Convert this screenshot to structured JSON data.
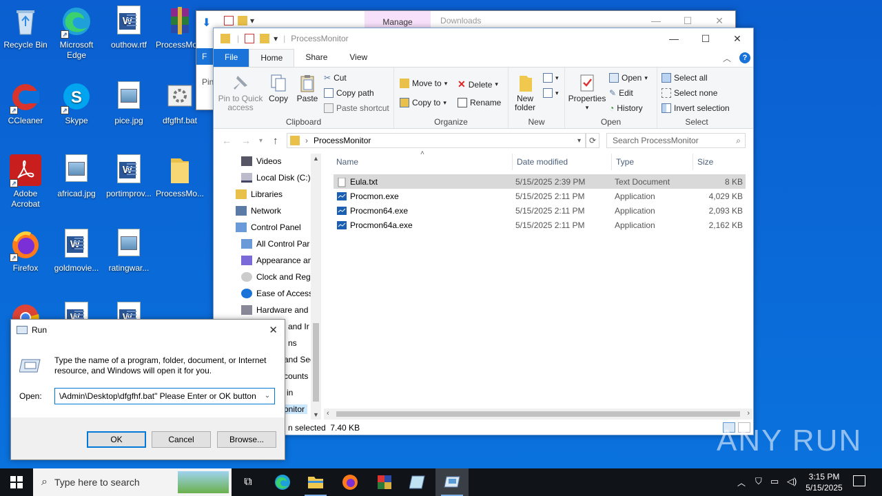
{
  "desktop_icons": [
    {
      "label": "Recycle Bin",
      "icon": "recycle-bin-icon"
    },
    {
      "label": "Microsoft Edge",
      "icon": "edge-icon"
    },
    {
      "label": "outhow.rtf",
      "icon": "word-doc-icon"
    },
    {
      "label": "ProcessMo...",
      "icon": "winrar-icon"
    },
    {
      "label": "CCleaner",
      "icon": "ccleaner-icon"
    },
    {
      "label": "Skype",
      "icon": "skype-icon"
    },
    {
      "label": "pice.jpg",
      "icon": "image-file-icon"
    },
    {
      "label": "dfgfhf.bat",
      "icon": "batch-file-icon"
    },
    {
      "label": "Adobe Acrobat",
      "icon": "acrobat-icon"
    },
    {
      "label": "africad.jpg",
      "icon": "image-file-icon"
    },
    {
      "label": "portimprov...",
      "icon": "word-doc-icon"
    },
    {
      "label": "ProcessMo...",
      "icon": "folder-icon"
    },
    {
      "label": "Firefox",
      "icon": "firefox-icon"
    },
    {
      "label": "goldmovie...",
      "icon": "word-doc-icon"
    },
    {
      "label": "ratingwar...",
      "icon": "image-file-icon"
    }
  ],
  "back_window": {
    "tab_manage": "Manage",
    "title": "Downloads",
    "file_tab": "F",
    "pin_label": "Pin"
  },
  "explorer": {
    "title": "ProcessMonitor",
    "tabs": [
      "File",
      "Home",
      "Share",
      "View"
    ],
    "clipboard": {
      "pin": "Pin to Quick access",
      "copy": "Copy",
      "paste": "Paste",
      "cut": "Cut",
      "copy_path": "Copy path",
      "paste_shortcut": "Paste shortcut",
      "label": "Clipboard"
    },
    "organize": {
      "move_to": "Move to",
      "copy_to": "Copy to",
      "delete": "Delete",
      "rename": "Rename",
      "label": "Organize"
    },
    "new": {
      "new_folder": "New folder",
      "label": "New"
    },
    "open": {
      "properties": "Properties",
      "open": "Open",
      "edit": "Edit",
      "history": "History",
      "label": "Open"
    },
    "select": {
      "select_all": "Select all",
      "select_none": "Select none",
      "invert": "Invert selection",
      "label": "Select"
    },
    "address": "ProcessMonitor",
    "search_placeholder": "Search ProcessMonitor",
    "tree": [
      "Videos",
      "Local Disk (C:)",
      "Libraries",
      "Network",
      "Control Panel",
      "All Control Par",
      "Appearance an",
      "Clock and Regi",
      "Ease of Access",
      "Hardware and",
      "and Ir",
      "ns",
      "and Sec",
      "counts",
      "in",
      "onitor"
    ],
    "columns": [
      "Name",
      "Date modified",
      "Type",
      "Size"
    ],
    "files": [
      {
        "name": "Eula.txt",
        "date": "5/15/2025 2:39 PM",
        "type": "Text Document",
        "size": "8 KB"
      },
      {
        "name": "Procmon.exe",
        "date": "5/15/2025 2:11 PM",
        "type": "Application",
        "size": "4,029 KB"
      },
      {
        "name": "Procmon64.exe",
        "date": "5/15/2025 2:11 PM",
        "type": "Application",
        "size": "2,093 KB"
      },
      {
        "name": "Procmon64a.exe",
        "date": "5/15/2025 2:11 PM",
        "type": "Application",
        "size": "2,162 KB"
      }
    ],
    "status": "n selected  7.40 KB"
  },
  "run_dialog": {
    "title": "Run",
    "description": "Type the name of a program, folder, document, or Internet resource, and Windows will open it for you.",
    "open_label": "Open:",
    "open_value": "\\Admin\\Desktop\\dfgfhf.bat\" Please Enter or OK button",
    "ok": "OK",
    "cancel": "Cancel",
    "browse": "Browse..."
  },
  "taskbar": {
    "search_placeholder": "Type here to search",
    "time": "3:15 PM",
    "date": "5/15/2025"
  },
  "watermark": "ANY RUN"
}
